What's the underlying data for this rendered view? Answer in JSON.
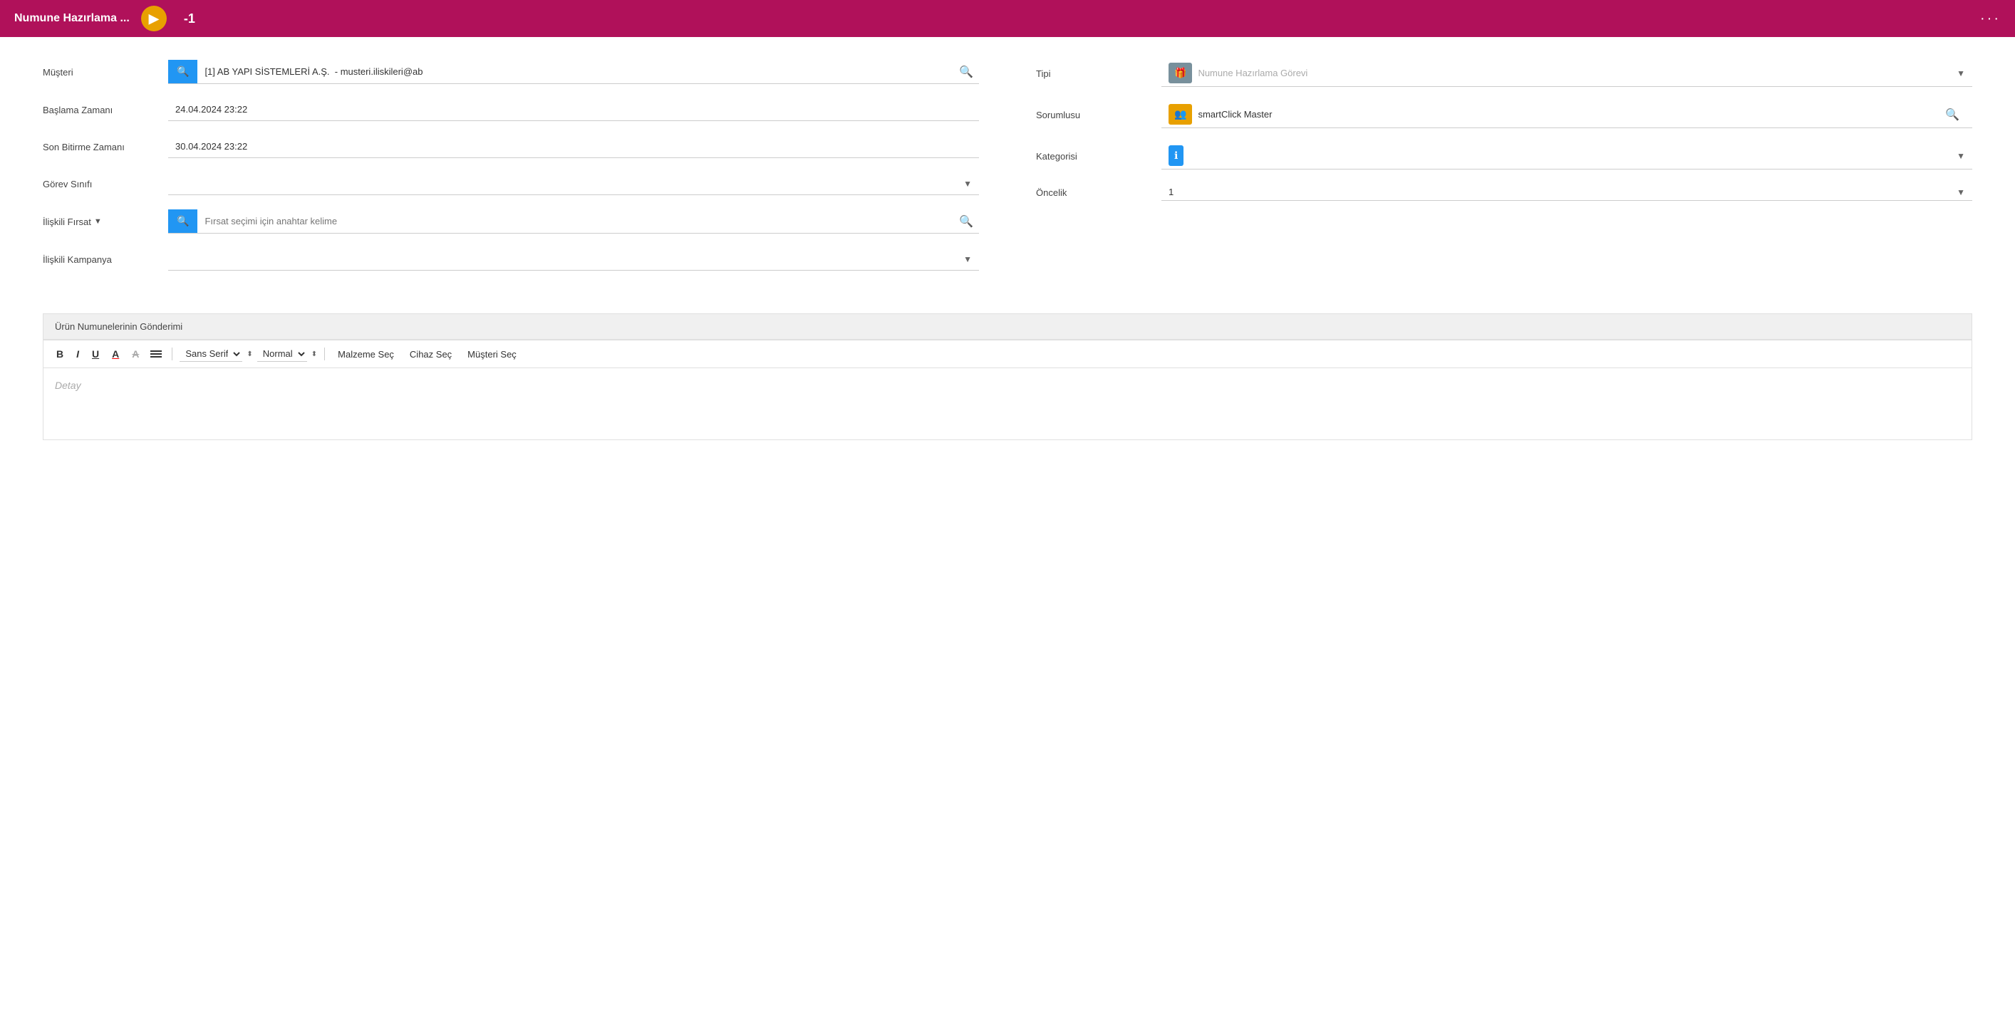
{
  "header": {
    "title": "Numune Hazırlama ...",
    "badge": "-1",
    "nav_btn_icon": "▶",
    "more_icon": "···"
  },
  "form": {
    "musteri_label": "Müşteri",
    "musteri_value": "[1] AB YAPI SİSTEMLERİ A.Ş.  - musteri.iliskileri@ab",
    "baslama_label": "Başlama Zamanı",
    "baslama_value": "24.04.2024 23:22",
    "son_bitirme_label": "Son Bitirme Zamanı",
    "son_bitirme_value": "30.04.2024 23:22",
    "gorev_sinifi_label": "Görev Sınıfı",
    "gorev_sinifi_placeholder": "",
    "iliskili_firsat_label": "İlişkili Fırsat",
    "iliskili_firsat_placeholder": "Fırsat seçimi için anahtar kelime",
    "iliskili_kampanya_label": "İlişkili Kampanya",
    "tipi_label": "Tipi",
    "tipi_value": "Numune Hazırlama Görevi",
    "sorumlusu_label": "Sorumlusu",
    "sorumlusu_value": "smartClick Master",
    "kategorisi_label": "Kategorisi",
    "oncelik_label": "Öncelik",
    "oncelik_value": "1"
  },
  "section": {
    "title": "Ürün Numunelerinin Gönderimi"
  },
  "toolbar": {
    "bold_label": "B",
    "italic_label": "I",
    "underline_label": "U",
    "font_color_label": "A",
    "strikethrough_label": "A",
    "font_family": "Sans Serif",
    "font_size": "Normal",
    "malzeme_sec": "Malzeme Seç",
    "cihaz_sec": "Cihaz Seç",
    "musteri_sec": "Müşteri Seç"
  },
  "editor": {
    "placeholder": "Detay"
  }
}
